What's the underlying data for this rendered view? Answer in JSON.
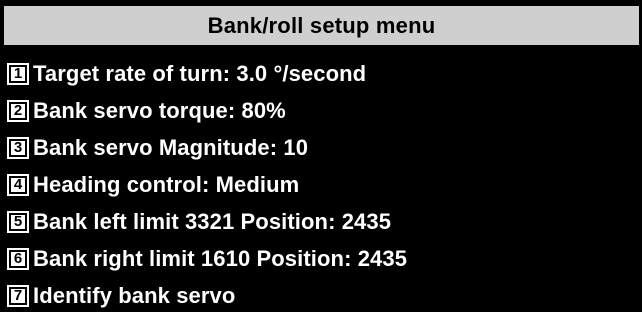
{
  "title": "Bank/roll setup menu",
  "menu": {
    "items": [
      {
        "key": "1",
        "label": "Target rate of turn: 3.0 °/second"
      },
      {
        "key": "2",
        "label": "Bank servo torque: 80%"
      },
      {
        "key": "3",
        "label": "Bank servo Magnitude: 10"
      },
      {
        "key": "4",
        "label": "Heading control: Medium"
      },
      {
        "key": "5",
        "label": "Bank left limit 3321 Position: 2435"
      },
      {
        "key": "6",
        "label": "Bank right limit 1610 Position: 2435"
      },
      {
        "key": "7",
        "label": "Identify bank servo"
      }
    ]
  },
  "colors": {
    "background": "#000000",
    "title_bar": "#cfcfcf",
    "text": "#ffffff"
  }
}
